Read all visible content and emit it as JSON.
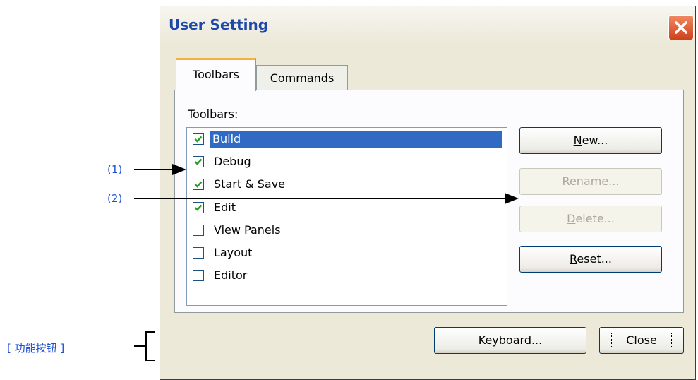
{
  "dialog": {
    "title": "User Setting",
    "tabs": [
      {
        "label": "Toolbars",
        "active": true
      },
      {
        "label": "Commands",
        "active": false
      }
    ],
    "group_label_prefix": "Toolb",
    "group_label_mnemonic": "a",
    "group_label_suffix": "rs:",
    "toolbars": [
      {
        "label": "Build",
        "checked": true,
        "selected": true
      },
      {
        "label": "Debug",
        "checked": true,
        "selected": false
      },
      {
        "label": "Start & Save",
        "checked": true,
        "selected": false
      },
      {
        "label": "Edit",
        "checked": true,
        "selected": false
      },
      {
        "label": "View Panels",
        "checked": false,
        "selected": false
      },
      {
        "label": "Layout",
        "checked": false,
        "selected": false
      },
      {
        "label": "Editor",
        "checked": false,
        "selected": false
      }
    ],
    "buttons": {
      "new": {
        "mnemonic": "N",
        "rest": "ew...",
        "enabled": true
      },
      "rename": {
        "pre": "R",
        "mnemonic": "e",
        "rest": "name...",
        "enabled": false
      },
      "delete": {
        "mnemonic": "D",
        "rest": "elete...",
        "enabled": false
      },
      "reset": {
        "mnemonic": "R",
        "rest": "eset...",
        "enabled": true
      },
      "keyboard": {
        "mnemonic": "K",
        "rest": "eyboard...",
        "enabled": true
      },
      "close": {
        "label": "Close",
        "enabled": true
      }
    }
  },
  "annotations": {
    "item1": "(1)",
    "item2": "(2)",
    "function_buttons": "[ 功能按钮 ]"
  },
  "colors": {
    "title_text": "#1d47a8",
    "selection": "#316ac5",
    "check": "#21a121",
    "annotation": "#1d4fd6",
    "tab_accent": "#f6b13b"
  }
}
